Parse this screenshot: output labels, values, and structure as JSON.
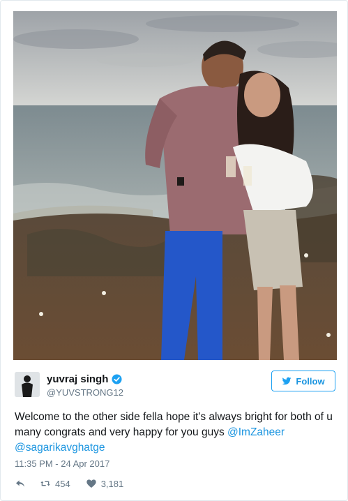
{
  "tweet": {
    "author": {
      "display_name": "yuvraj singh",
      "handle": "@YUVSTRONG12",
      "verified": true
    },
    "follow_button": {
      "label": "Follow",
      "icon": "twitter-bird-icon"
    },
    "text_parts": [
      "Welcome to the other side fella hope it's always bright for both of u many congrats and very happy for you guys ",
      "@ImZaheer",
      " ",
      "@sagarikavghatge"
    ],
    "timestamp": "11:35 PM - 24 Apr 2017",
    "actions": {
      "reply_icon": "reply-icon",
      "retweet_icon": "retweet-icon",
      "retweet_count": "454",
      "like_icon": "heart-icon",
      "like_count": "3,181"
    }
  },
  "colors": {
    "accent": "#1da1f2",
    "link": "#1b95e0",
    "text": "#14171a",
    "muted": "#657786",
    "border": "#e1e8ed"
  }
}
